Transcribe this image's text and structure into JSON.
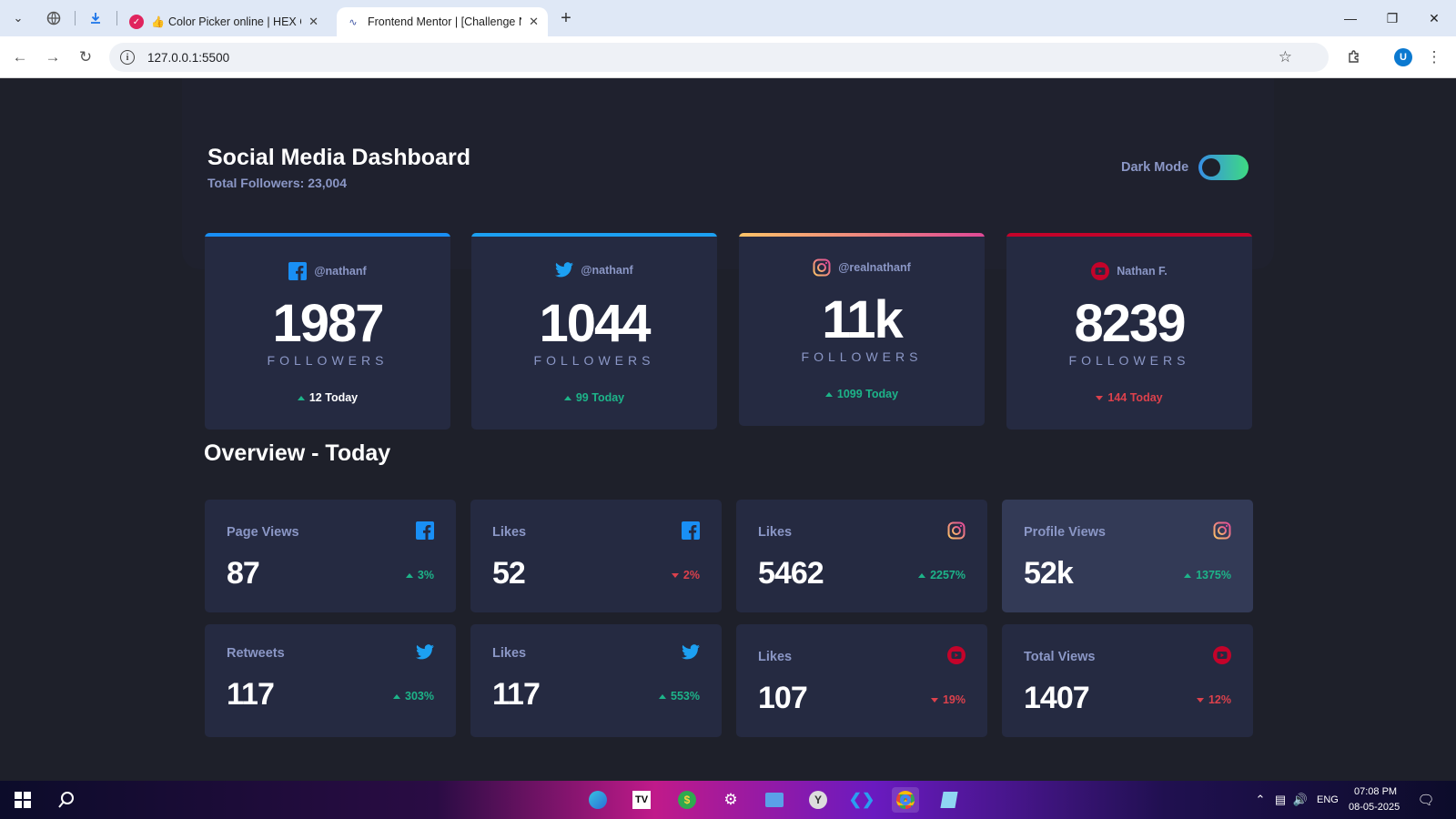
{
  "browser": {
    "tabs": [
      {
        "title": "Color Picker online | HEX Co"
      },
      {
        "title": "Frontend Mentor | [Challenge N"
      }
    ],
    "url": "127.0.0.1:5500",
    "profile_initial": "U"
  },
  "header": {
    "title": "Social Media Dashboard",
    "subtitle": "Total Followers: 23,004",
    "dark_mode_label": "Dark Mode"
  },
  "follower_cards": [
    {
      "network": "facebook",
      "icon": "facebook-icon",
      "handle": "@nathanf",
      "count": "1987",
      "label": "FOLLOWERS",
      "today": "12 Today",
      "trend": "up",
      "accent": "#198ff5"
    },
    {
      "network": "twitter",
      "icon": "twitter-icon",
      "handle": "@nathanf",
      "count": "1044",
      "label": "FOLLOWERS",
      "today": "99 Today",
      "trend": "up",
      "accent": "#1ca0f2"
    },
    {
      "network": "instagram",
      "icon": "instagram-icon",
      "handle": "@realnathanf",
      "count": "11k",
      "label": "FOLLOWERS",
      "today": "1099 Today",
      "trend": "up",
      "accent": "#df4996"
    },
    {
      "network": "youtube",
      "icon": "youtube-icon",
      "handle": "Nathan F.",
      "count": "8239",
      "label": "FOLLOWERS",
      "today": "144 Today",
      "trend": "down",
      "accent": "#c4032a"
    }
  ],
  "overview": {
    "title": "Overview - Today",
    "cards": [
      {
        "label": "Page Views",
        "icon": "facebook-icon",
        "value": "87",
        "pct": "3%",
        "trend": "up"
      },
      {
        "label": "Likes",
        "icon": "facebook-icon",
        "value": "52",
        "pct": "2%",
        "trend": "down"
      },
      {
        "label": "Likes",
        "icon": "instagram-icon",
        "value": "5462",
        "pct": "2257%",
        "trend": "up"
      },
      {
        "label": "Profile Views",
        "icon": "instagram-icon",
        "value": "52k",
        "pct": "1375%",
        "trend": "up"
      },
      {
        "label": "Retweets",
        "icon": "twitter-icon",
        "value": "117",
        "pct": "303%",
        "trend": "up"
      },
      {
        "label": "Likes",
        "icon": "twitter-icon",
        "value": "117",
        "pct": "553%",
        "trend": "up"
      },
      {
        "label": "Likes",
        "icon": "youtube-icon",
        "value": "107",
        "pct": "19%",
        "trend": "down"
      },
      {
        "label": "Total Views",
        "icon": "youtube-icon",
        "value": "1407",
        "pct": "12%",
        "trend": "down"
      }
    ]
  },
  "colors": {
    "background": "#1e202a",
    "card": "#252a41",
    "card_hover": "#333a56",
    "text_muted": "#8b97c6",
    "up": "#1db489",
    "down": "#dc414c"
  },
  "taskbar": {
    "time": "07:08 PM",
    "date": "08-05-2025",
    "language": "ENG"
  }
}
